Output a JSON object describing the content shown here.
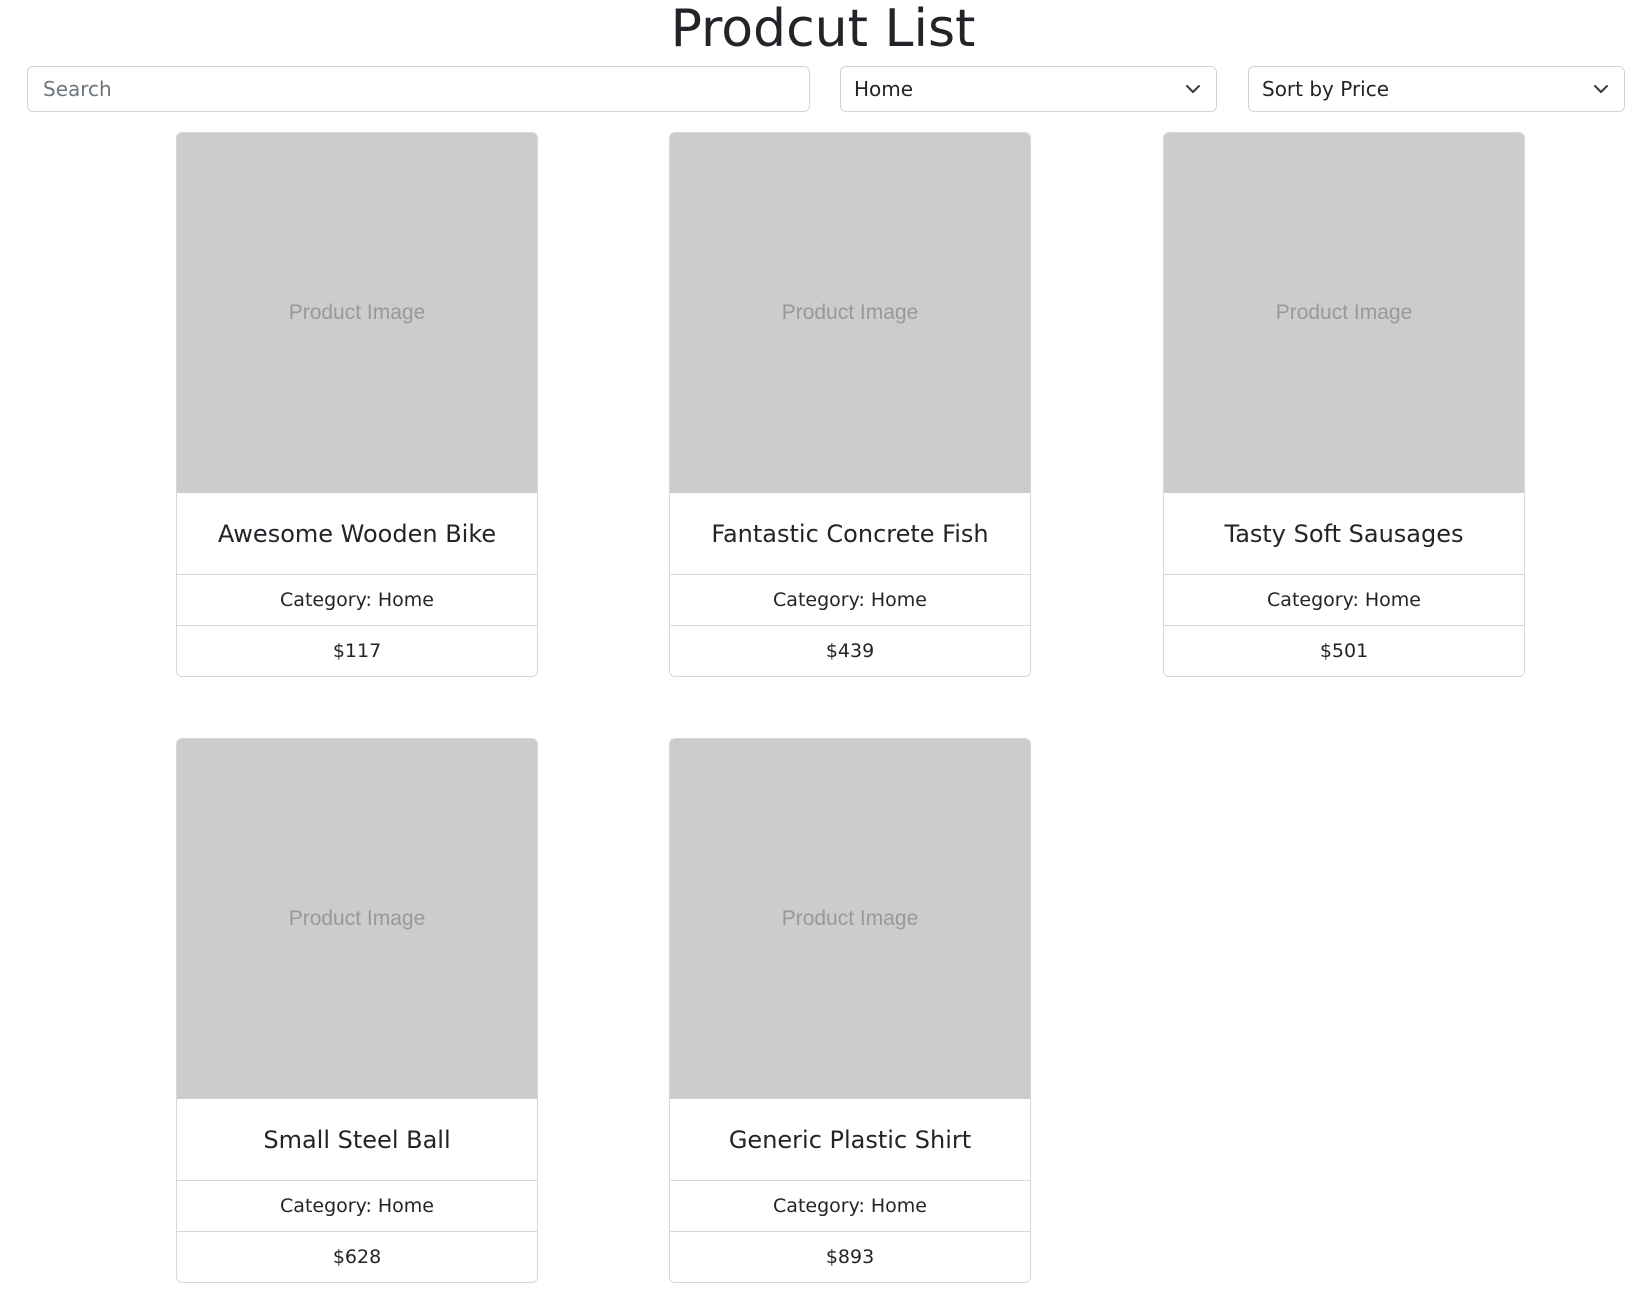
{
  "header": {
    "title": "Prodcut List"
  },
  "filters": {
    "search_placeholder": "Search",
    "search_value": "",
    "category_selected": "Home",
    "sort_selected": "Sort by Price"
  },
  "products": [
    {
      "image_label": "Product Image",
      "name": "Awesome Wooden Bike",
      "category_label": "Category:",
      "category": "Home",
      "price": "$117"
    },
    {
      "image_label": "Product Image",
      "name": "Fantastic Concrete Fish",
      "category_label": "Category:",
      "category": "Home",
      "price": "$439"
    },
    {
      "image_label": "Product Image",
      "name": "Tasty Soft Sausages",
      "category_label": "Category:",
      "category": "Home",
      "price": "$501"
    },
    {
      "image_label": "Product Image",
      "name": "Small Steel Ball",
      "category_label": "Category:",
      "category": "Home",
      "price": "$628"
    },
    {
      "image_label": "Product Image",
      "name": "Generic Plastic Shirt",
      "category_label": "Category:",
      "category": "Home",
      "price": "$893"
    }
  ],
  "icons": {
    "select_arrow": "chevron-down-icon"
  },
  "colors": {
    "image_placeholder": "#cccccc",
    "border": "#d5d8db",
    "text": "#212529"
  }
}
